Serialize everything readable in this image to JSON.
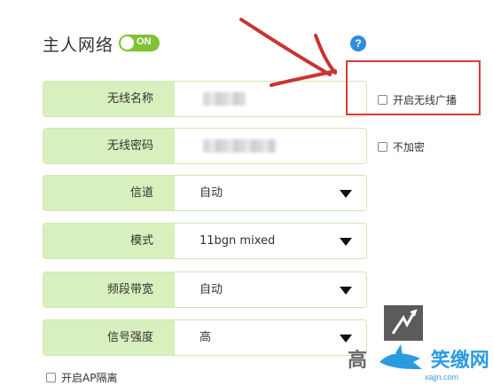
{
  "header": {
    "title": "主人网络",
    "toggle_label": "ON",
    "help_icon_text": "?"
  },
  "fields": [
    {
      "label": "无线名称",
      "value": ""
    },
    {
      "label": "无线密码",
      "value": ""
    },
    {
      "label": "信道",
      "value": "自动"
    },
    {
      "label": "模式",
      "value": "11bgn mixed"
    },
    {
      "label": "频段带宽",
      "value": "自动"
    },
    {
      "label": "信号强度",
      "value": "高"
    }
  ],
  "options": {
    "broadcast": "开启无线广播",
    "no_encrypt": "不加密",
    "ap_isolation": "开启AP隔离"
  },
  "watermark": {
    "text": "高",
    "brand": "笑缴网",
    "site": "xajjn.com"
  },
  "colors": {
    "accent_green": "#7fc236",
    "label_bg": "#d8f0bd",
    "annotation_red": "#d93a3a",
    "help_blue": "#2e8de0"
  }
}
